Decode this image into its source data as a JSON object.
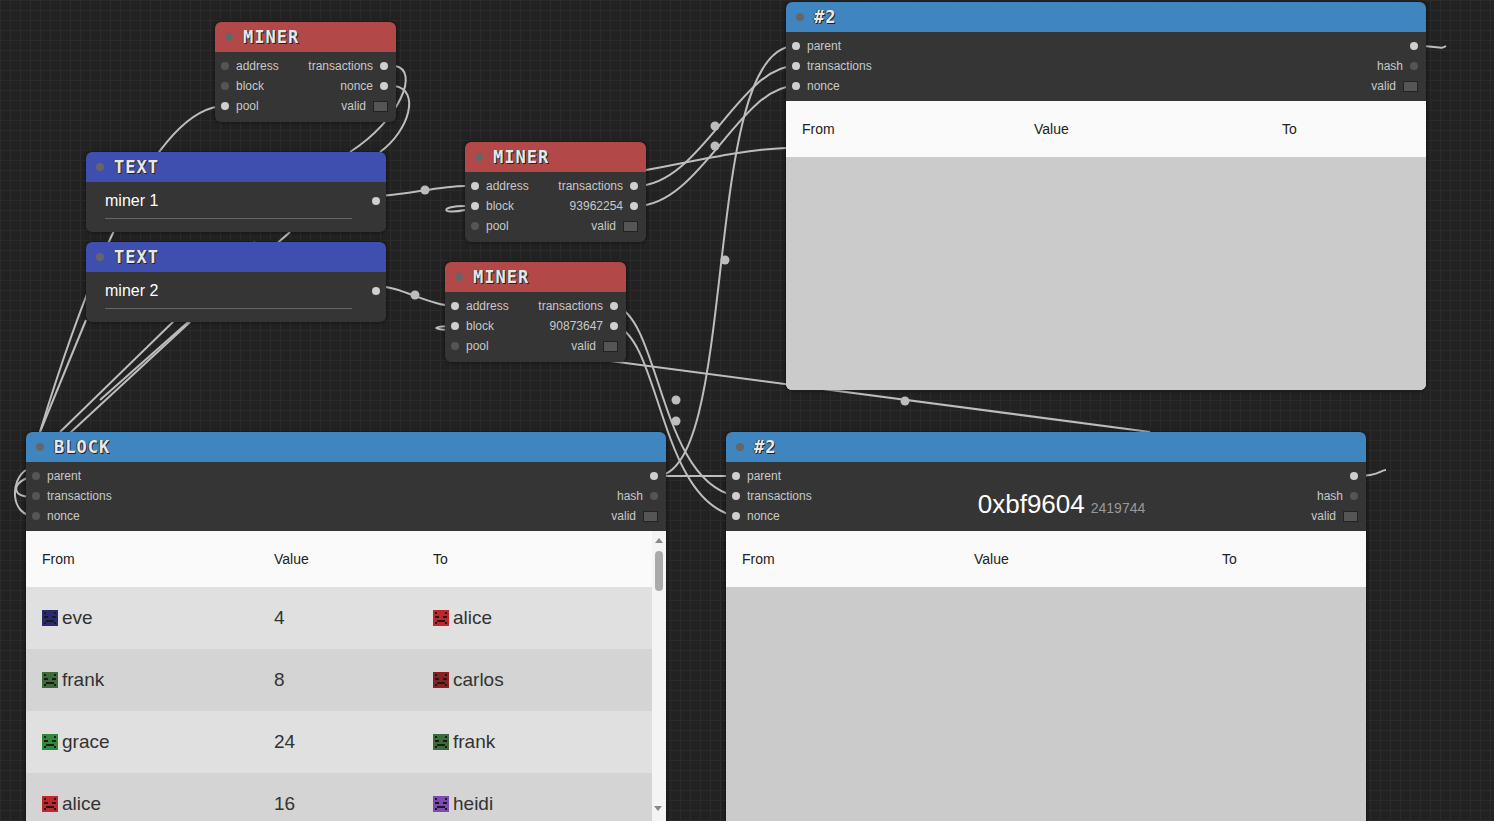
{
  "nodes": [
    {
      "kind": "miner",
      "title": "MINER",
      "inputs": [
        {
          "label": "address",
          "connected": false
        },
        {
          "label": "block",
          "connected": false
        },
        {
          "label": "pool",
          "connected": true
        }
      ],
      "outputs": [
        {
          "label": "transactions",
          "connected": true
        },
        {
          "label": "nonce",
          "connected": true
        }
      ],
      "valid": {
        "label": "valid",
        "checked": false
      }
    },
    {
      "kind": "text",
      "title": "TEXT",
      "value": "miner 1",
      "connected": true
    },
    {
      "kind": "text",
      "title": "TEXT",
      "value": "miner 2",
      "connected": true
    },
    {
      "kind": "miner",
      "title": "MINER",
      "inputs": [
        {
          "label": "address",
          "connected": true
        },
        {
          "label": "block",
          "connected": true
        },
        {
          "label": "pool",
          "connected": false
        }
      ],
      "outputs": [
        {
          "label": "transactions",
          "connected": true
        },
        {
          "label": "93962254",
          "connected": true
        }
      ],
      "valid": {
        "label": "valid",
        "checked": false
      }
    },
    {
      "kind": "miner",
      "title": "MINER",
      "inputs": [
        {
          "label": "address",
          "connected": true
        },
        {
          "label": "block",
          "connected": true
        },
        {
          "label": "pool",
          "connected": false
        }
      ],
      "outputs": [
        {
          "label": "transactions",
          "connected": true
        },
        {
          "label": "90873647",
          "connected": true
        }
      ],
      "valid": {
        "label": "valid",
        "checked": false
      }
    },
    {
      "kind": "block",
      "title": "#2",
      "inputs": [
        {
          "label": "parent",
          "connected": true
        },
        {
          "label": "transactions",
          "connected": true
        },
        {
          "label": "nonce",
          "connected": true
        }
      ],
      "output_connected": true,
      "hash": {
        "label": "hash",
        "connected": false
      },
      "valid": {
        "label": "valid",
        "checked": false
      },
      "columns": [
        "From",
        "Value",
        "To"
      ],
      "rows": []
    },
    {
      "kind": "block",
      "title": "BLOCK",
      "inputs": [
        {
          "label": "parent",
          "connected": false
        },
        {
          "label": "transactions",
          "connected": false
        },
        {
          "label": "nonce",
          "connected": false
        }
      ],
      "output_connected": true,
      "hash": {
        "label": "hash",
        "connected": false
      },
      "valid": {
        "label": "valid",
        "checked": false
      },
      "columns": [
        "From",
        "Value",
        "To"
      ],
      "rows": [
        {
          "from": {
            "name": "eve",
            "color": "#2a2a6e"
          },
          "value": "4",
          "to": {
            "name": "alice",
            "color": "#c0262b"
          }
        },
        {
          "from": {
            "name": "frank",
            "color": "#3d6b3a"
          },
          "value": "8",
          "to": {
            "name": "carlos",
            "color": "#8a2020"
          }
        },
        {
          "from": {
            "name": "grace",
            "color": "#2f8a3c"
          },
          "value": "24",
          "to": {
            "name": "frank",
            "color": "#3d6b3a"
          }
        },
        {
          "from": {
            "name": "alice",
            "color": "#c0262b"
          },
          "value": "16",
          "to": {
            "name": "heidi",
            "color": "#7a4bb0"
          }
        }
      ]
    },
    {
      "kind": "block",
      "title": "#2",
      "display": {
        "hash": "0xbf9604",
        "nonce": "2419744"
      },
      "inputs": [
        {
          "label": "parent",
          "connected": true
        },
        {
          "label": "transactions",
          "connected": true
        },
        {
          "label": "nonce",
          "connected": true
        }
      ],
      "output_connected": true,
      "hash": {
        "label": "hash",
        "connected": false
      },
      "valid": {
        "label": "valid",
        "checked": false
      },
      "columns": [
        "From",
        "Value",
        "To"
      ],
      "rows": []
    }
  ]
}
